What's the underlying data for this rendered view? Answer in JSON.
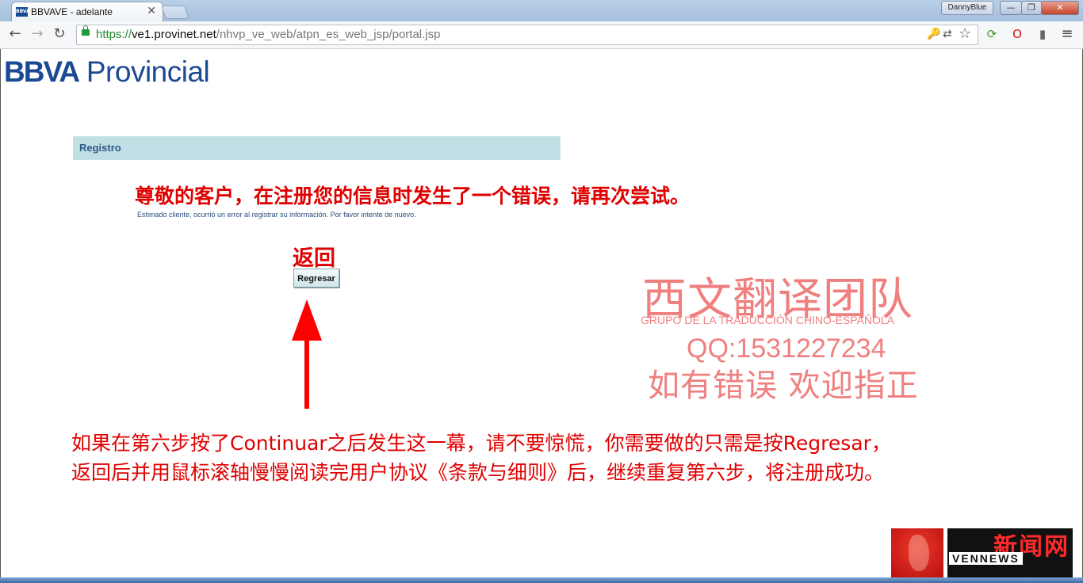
{
  "browser": {
    "tab_title": "BBVAVE - adelante",
    "favicon_text": "BBVA",
    "tab_close": "✕",
    "profile_name": "DannyBlue",
    "url_scheme": "https://",
    "url_host": "ve1.provinet.net",
    "url_path": "/nhvp_ve_web/atpn_es_web_jsp/portal.jsp",
    "window_minimize": "—",
    "window_maximize": "❐",
    "window_close": "✕",
    "nav_back": "←",
    "nav_forward": "→",
    "nav_reload": "↻",
    "key_icon": "🔑",
    "translate_icon": "⇄",
    "star_icon": "☆",
    "menu_icon": "≡"
  },
  "page": {
    "logo_bbva": "BBVA",
    "logo_provincial": "Provincial",
    "panel_title": "Registro",
    "error_message": "Estimado cliente, ocurrió un error al registrar su información. Por favor intente de nuevo.",
    "regresar_label": "Regresar"
  },
  "annotations": {
    "error_zh": "尊敬的客户，在注册您的信息时发生了一个错误，请再次尝试。",
    "back_zh": "返回",
    "instruction_line1": "如果在第六步按了Continuar之后发生这一幕，请不要惊慌，你需要做的只需是按Regresar，",
    "instruction_line2": "返回后并用鼠标滚轴慢慢阅读完用户协议《条款与细则》后，继续重复第六步，将注册成功。"
  },
  "watermark": {
    "title_zh": "西文翻译团队",
    "subtitle": "GRUPO DE LA TRADUCCIÓN CHINO-ESPAÑOLA",
    "qq": "QQ:1531227234",
    "welcome_zh": "如有错误 欢迎指正"
  },
  "corner_badge": {
    "zh": "新闻网",
    "en": "VENNEWS"
  },
  "colors": {
    "annotation_red": "#e00000",
    "watermark_pink": "#f07f7f",
    "bbva_blue": "#1b4a93",
    "panel_bg": "#c3dfe6"
  }
}
